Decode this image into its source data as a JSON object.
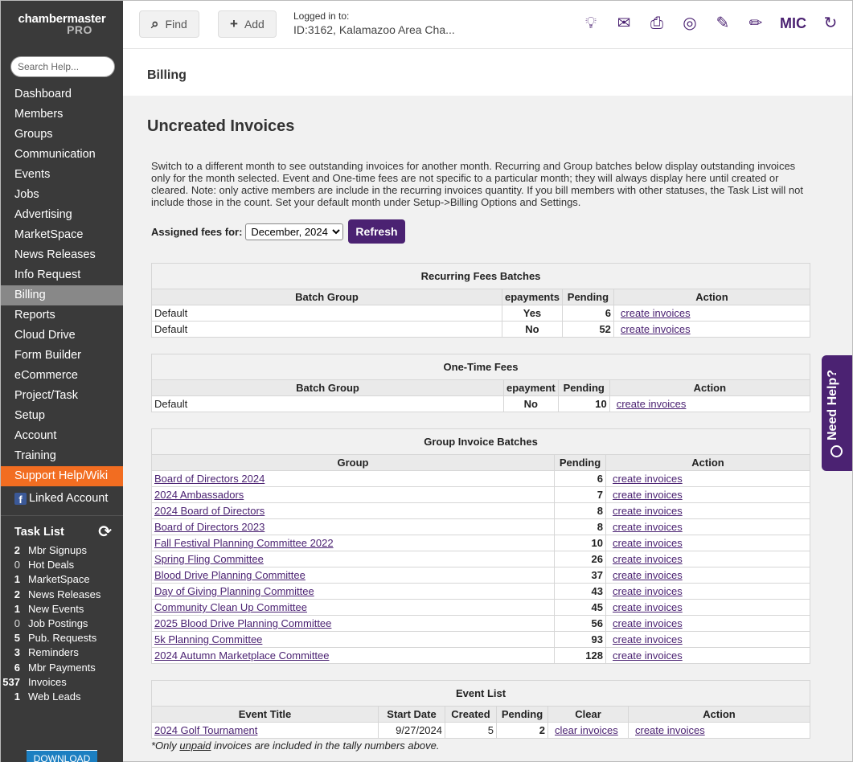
{
  "brand": {
    "name": "chambermaster",
    "edition": "PRO"
  },
  "search": {
    "placeholder": "Search Help..."
  },
  "nav": [
    "Dashboard",
    "Members",
    "Groups",
    "Communication",
    "Events",
    "Jobs",
    "Advertising",
    "MarketSpace",
    "News Releases",
    "Info Request",
    "Billing",
    "Reports",
    "Cloud Drive",
    "Form Builder",
    "eCommerce",
    "Project/Task",
    "Setup",
    "Account",
    "Training",
    "Support Help/Wiki"
  ],
  "linked_account": "Linked Account",
  "task_list": {
    "title": "Task List",
    "items": [
      {
        "count": "2",
        "label": "Mbr Signups"
      },
      {
        "count": "0",
        "label": "Hot Deals"
      },
      {
        "count": "1",
        "label": "MarketSpace"
      },
      {
        "count": "2",
        "label": "News Releases"
      },
      {
        "count": "1",
        "label": "New Events"
      },
      {
        "count": "0",
        "label": "Job Postings"
      },
      {
        "count": "5",
        "label": "Pub. Requests"
      },
      {
        "count": "3",
        "label": "Reminders"
      },
      {
        "count": "6",
        "label": "Mbr Payments"
      },
      {
        "count": "537",
        "label": "Invoices"
      },
      {
        "count": "1",
        "label": "Web Leads"
      }
    ]
  },
  "download_label": "DOWNLOAD",
  "topbar": {
    "find_label": "Find",
    "add_label": "Add",
    "logged_in_label": "Logged in to:",
    "logged_in_value": "ID:3162, Kalamazoo Area Cha...",
    "initials": "MIC"
  },
  "breadcrumb": "Billing",
  "page_title": "Uncreated Invoices",
  "description": "Switch to a different month to see outstanding invoices for another month. Recurring and Group batches below display outstanding invoices only for the month selected. Event and One-time fees are not specific to a particular month; they will always display here until created or cleared. Note: only active members are include in the recurring invoices quantity. If you bill members with other statuses, the Task List will not include those in the count. Set your default month under Setup->Billing Options and Settings.",
  "assigned": {
    "label": "Assigned fees for:",
    "selected": "December, 2024",
    "refresh_label": "Refresh"
  },
  "action_link": "create invoices",
  "recurring": {
    "title": "Recurring Fees Batches",
    "headers": [
      "Batch Group",
      "epayments",
      "Pending",
      "Action"
    ],
    "rows": [
      {
        "group": "Default",
        "epay": "Yes",
        "pending": "6"
      },
      {
        "group": "Default",
        "epay": "No",
        "pending": "52"
      }
    ]
  },
  "onetime": {
    "title": "One-Time Fees",
    "headers": [
      "Batch Group",
      "epayment",
      "Pending",
      "Action"
    ],
    "rows": [
      {
        "group": "Default",
        "epay": "No",
        "pending": "10"
      }
    ]
  },
  "group_batches": {
    "title": "Group Invoice Batches",
    "headers": [
      "Group",
      "Pending",
      "Action"
    ],
    "rows": [
      {
        "group": "Board of Directors 2024",
        "pending": "6"
      },
      {
        "group": "2024 Ambassadors",
        "pending": "7"
      },
      {
        "group": "2024 Board of Directors",
        "pending": "8"
      },
      {
        "group": "Board of Directors 2023",
        "pending": "8"
      },
      {
        "group": "Fall Festival Planning Committee 2022",
        "pending": "10"
      },
      {
        "group": "Spring Fling Committee",
        "pending": "26"
      },
      {
        "group": "Blood Drive Planning Committee",
        "pending": "37"
      },
      {
        "group": "Day of Giving Planning Committee",
        "pending": "43"
      },
      {
        "group": "Community Clean Up Committee",
        "pending": "45"
      },
      {
        "group": "2025 Blood Drive Planning Committee",
        "pending": "56"
      },
      {
        "group": "5k Planning Committee",
        "pending": "93"
      },
      {
        "group": "2024 Autumn Marketplace Committee",
        "pending": "128"
      }
    ]
  },
  "events": {
    "title": "Event List",
    "headers": [
      "Event Title",
      "Start Date",
      "Created",
      "Pending",
      "Clear",
      "Action"
    ],
    "rows": [
      {
        "title": "2024 Golf Tournament",
        "start": "9/27/2024",
        "created": "5",
        "pending": "2",
        "clear": "clear invoices"
      }
    ]
  },
  "footnote": {
    "pre": "*Only ",
    "em": "unpaid",
    "post": " invoices are included in the tally numbers above."
  },
  "need_help": "Need Help?"
}
